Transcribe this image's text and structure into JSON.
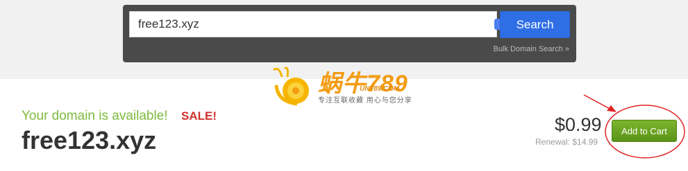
{
  "search": {
    "value": "free123.xyz",
    "button_label": "Search",
    "bulk_link": "Bulk Domain Search »"
  },
  "watermark": {
    "title": "蜗牛789",
    "domain": "UN789.COM",
    "slogan": "专注互联收藏 用心与您分享"
  },
  "result": {
    "available_text": "Your domain is available!",
    "sale_badge": "SALE!",
    "domain": "free123.xyz",
    "price": "$0.99",
    "renewal": "Renewal: $14.99",
    "add_to_cart_label": "Add to Cart"
  },
  "colors": {
    "available": "#7dbb3c",
    "sale": "#d0302b",
    "search_button": "#2f6fe6",
    "cart_button": "#6aa524",
    "annotation": "#e02020"
  }
}
